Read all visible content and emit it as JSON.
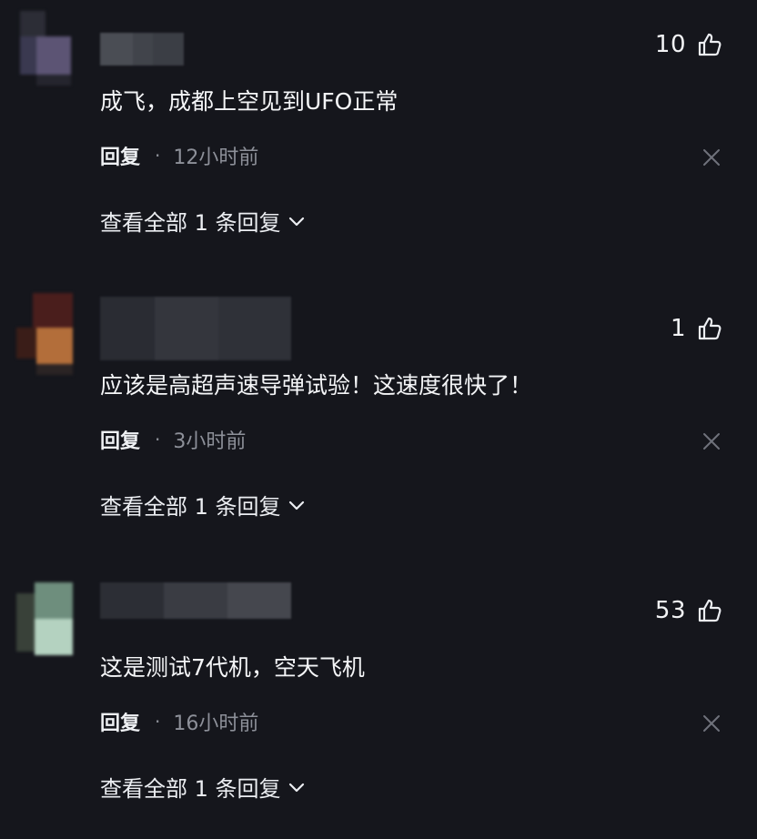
{
  "comments": [
    {
      "likes": "10",
      "text": "成飞，成都上空见到UFO正常",
      "reply_label": "回复",
      "separator": "·",
      "time": "12小时前",
      "view_replies": "查看全部 1 条回复"
    },
    {
      "likes": "1",
      "text": "应该是高超声速导弹试验！这速度很快了！",
      "reply_label": "回复",
      "separator": "·",
      "time": "3小时前",
      "view_replies": "查看全部 1 条回复"
    },
    {
      "likes": "53",
      "text": "这是测试7代机，空天飞机",
      "reply_label": "回复",
      "separator": "·",
      "time": "16小时前",
      "view_replies": "查看全部 1 条回复"
    }
  ],
  "icons": {
    "like": "thumbs-up-icon",
    "close": "close-icon",
    "expand": "chevron-down-icon"
  },
  "colors": {
    "background": "#15161c",
    "primary_text": "#f4f5f7",
    "secondary_text": "#8d9099"
  }
}
